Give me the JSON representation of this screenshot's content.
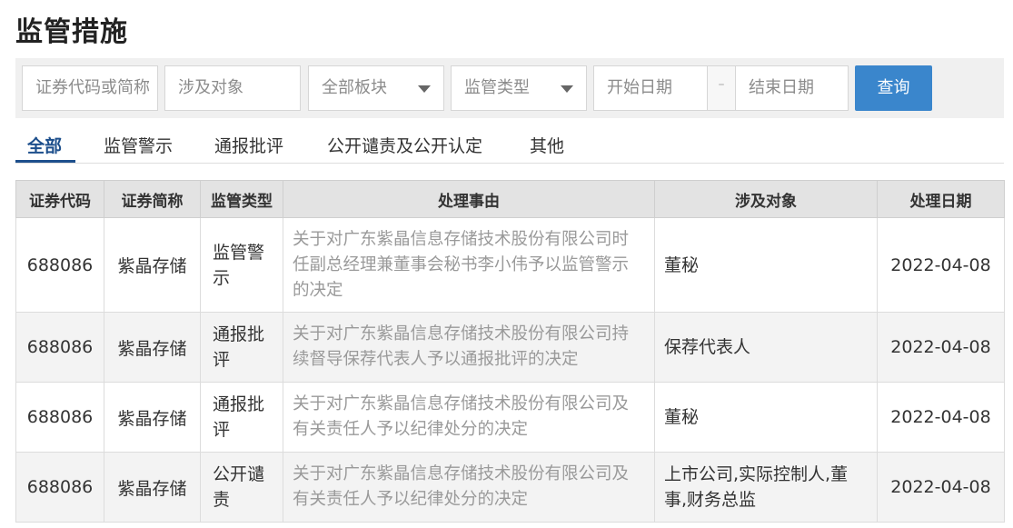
{
  "page": {
    "title": "监管措施"
  },
  "filters": {
    "code_placeholder": "证券代码或简称",
    "target_placeholder": "涉及对象",
    "board_select": "全部板块",
    "type_select": "监管类型",
    "start_date_placeholder": "开始日期",
    "date_separator": "–",
    "end_date_placeholder": "结束日期",
    "query_button": "查询"
  },
  "tabs": [
    {
      "label": "全部",
      "active": true
    },
    {
      "label": "监管警示",
      "active": false
    },
    {
      "label": "通报批评",
      "active": false
    },
    {
      "label": "公开谴责及公开认定",
      "active": false
    },
    {
      "label": "其他",
      "active": false
    }
  ],
  "table": {
    "headers": [
      "证券代码",
      "证券简称",
      "监管类型",
      "处理事由",
      "涉及对象",
      "处理日期"
    ],
    "rows": [
      {
        "code": "688086",
        "name": "紫晶存储",
        "type": "监管警示",
        "reason": "关于对广东紫晶信息存储技术股份有限公司时任副总经理兼董事会秘书李小伟予以监管警示的决定",
        "target": "董秘",
        "date": "2022-04-08"
      },
      {
        "code": "688086",
        "name": "紫晶存储",
        "type": "通报批评",
        "reason": "关于对广东紫晶信息存储技术股份有限公司持续督导保荐代表人予以通报批评的决定",
        "target": "保荐代表人",
        "date": "2022-04-08"
      },
      {
        "code": "688086",
        "name": "紫晶存储",
        "type": "通报批评",
        "reason": "关于对广东紫晶信息存储技术股份有限公司及有关责任人予以纪律处分的决定",
        "target": "董秘",
        "date": "2022-04-08"
      },
      {
        "code": "688086",
        "name": "紫晶存储",
        "type": "公开谴责",
        "reason": "关于对广东紫晶信息存储技术股份有限公司及有关责任人予以纪律处分的决定",
        "target": "上市公司,实际控制人,董事,财务总监",
        "date": "2022-04-08"
      }
    ]
  }
}
